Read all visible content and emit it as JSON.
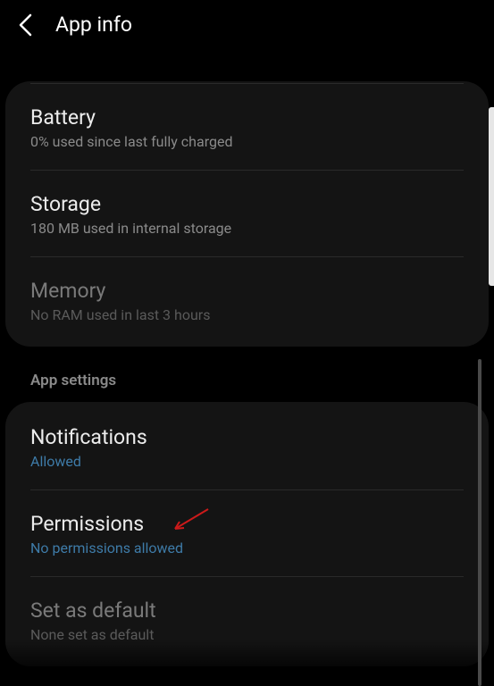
{
  "header": {
    "title": "App info"
  },
  "usage": {
    "battery": {
      "title": "Battery",
      "subtitle": "0% used since last fully charged"
    },
    "storage": {
      "title": "Storage",
      "subtitle": "180 MB used in internal storage"
    },
    "memory": {
      "title": "Memory",
      "subtitle": "No RAM used in last 3 hours"
    }
  },
  "section_header": "App settings",
  "settings": {
    "notifications": {
      "title": "Notifications",
      "subtitle": "Allowed"
    },
    "permissions": {
      "title": "Permissions",
      "subtitle": "No permissions allowed"
    },
    "set_default": {
      "title": "Set as default",
      "subtitle": "None set as default"
    }
  }
}
